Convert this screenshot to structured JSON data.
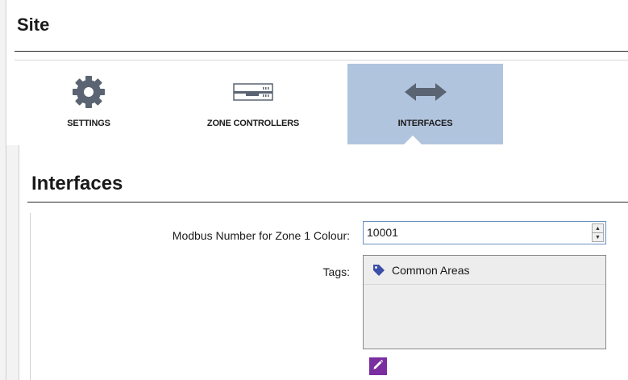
{
  "site": {
    "title": "Site"
  },
  "tabs": [
    {
      "label": "SETTINGS",
      "icon": "gear-icon",
      "selected": false
    },
    {
      "label": "ZONE CONTROLLERS",
      "icon": "zone-controller-icon",
      "selected": false
    },
    {
      "label": "INTERFACES",
      "icon": "interfaces-arrows-icon",
      "selected": true
    }
  ],
  "interfaces": {
    "title": "Interfaces",
    "modbus_label": "Modbus Number for Zone 1 Colour:",
    "modbus_value": "10001",
    "tags_label": "Tags:",
    "tags": [
      {
        "label": "Common Areas",
        "icon": "tag-icon"
      }
    ],
    "edit_icon": "pencil-icon"
  },
  "colors": {
    "selected_tab": "#b1c4de",
    "tag_icon": "#3d4ea8",
    "edit_button": "#7a2e9f",
    "icon_gray": "#5a6472"
  }
}
